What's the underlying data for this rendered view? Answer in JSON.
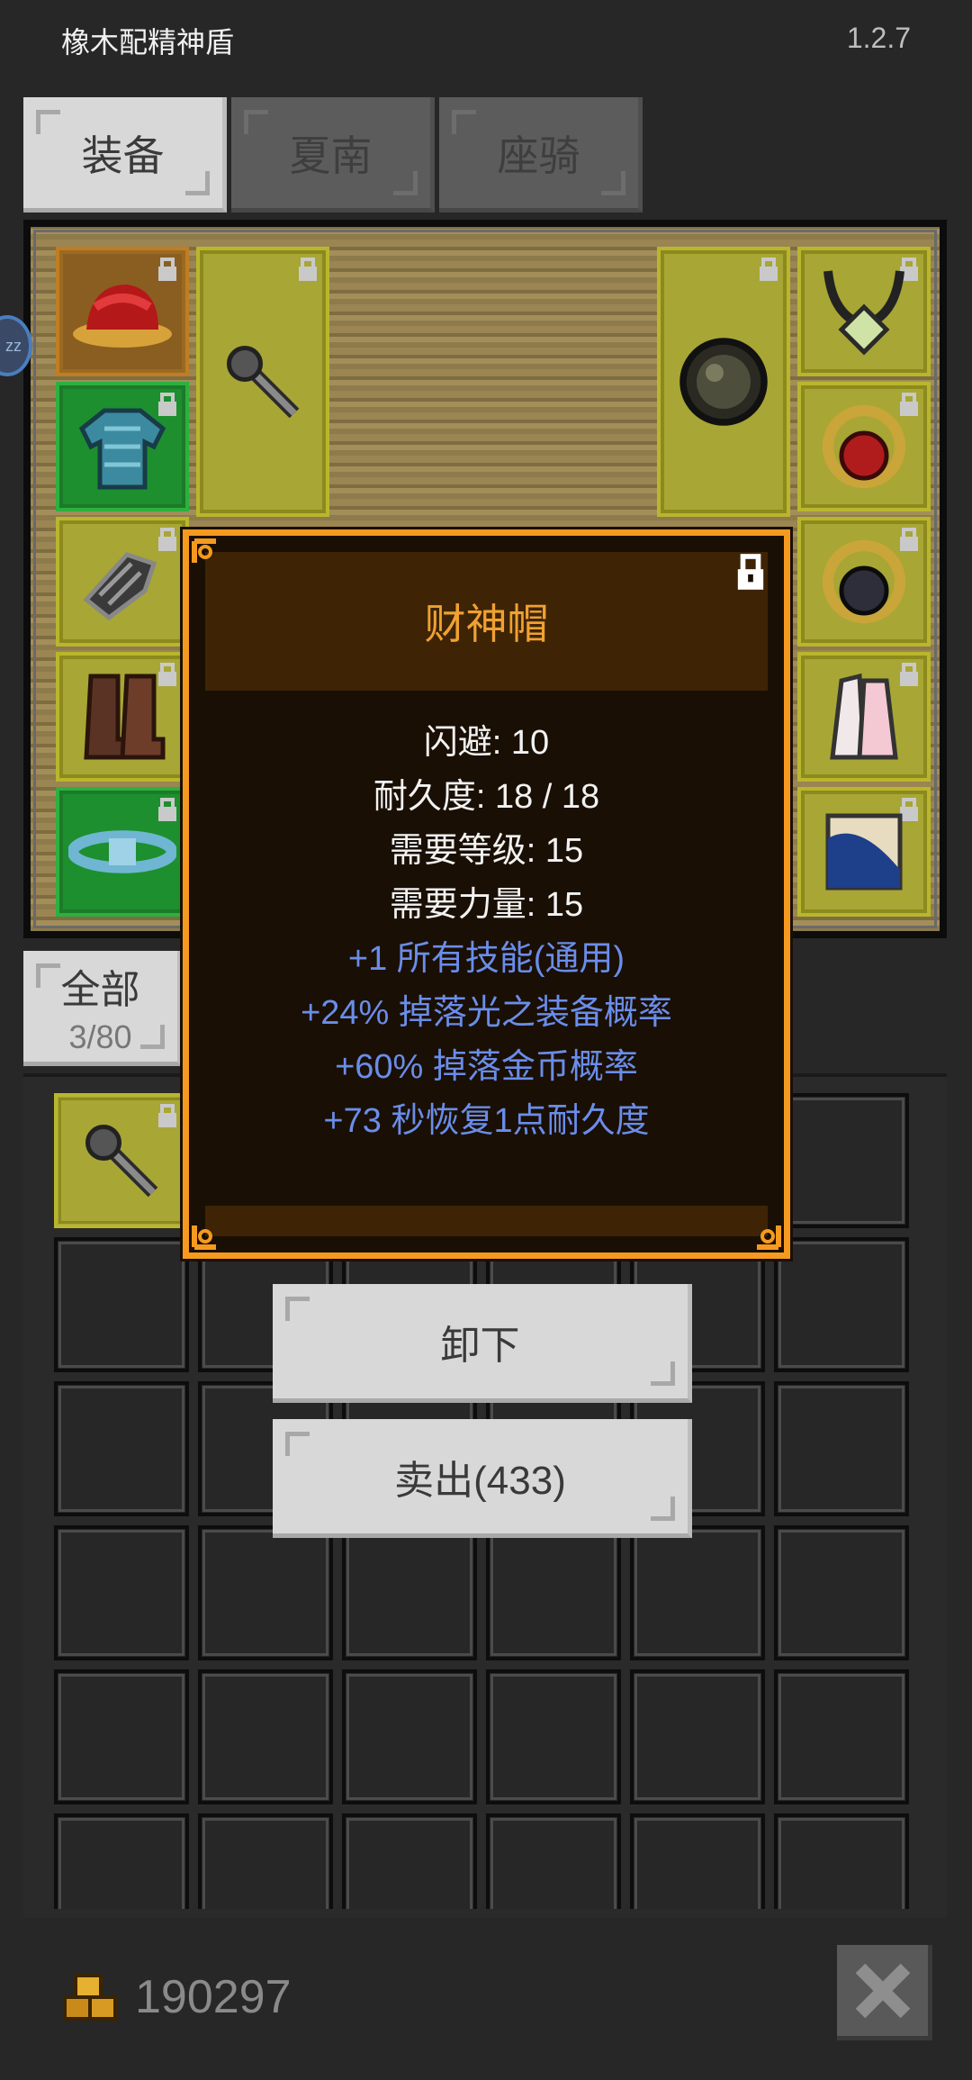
{
  "header": {
    "title": "橡木配精神盾",
    "version": "1.2.7"
  },
  "tabs": [
    {
      "label": "装备",
      "active": true
    },
    {
      "label": "夏南",
      "active": false
    },
    {
      "label": "座骑",
      "active": false
    }
  ],
  "side_badge": "zz",
  "equipment_slots": [
    {
      "slot": "head",
      "icon": "red-hat-icon",
      "locked": true
    },
    {
      "slot": "weapon",
      "icon": "mace-icon",
      "locked": true
    },
    {
      "slot": "offhand",
      "icon": "round-shield-icon",
      "locked": true
    },
    {
      "slot": "amulet",
      "icon": "amulet-icon",
      "locked": true
    },
    {
      "slot": "armor",
      "icon": "chainmail-icon",
      "locked": true
    },
    {
      "slot": "ring-1",
      "icon": "ruby-ring-icon",
      "locked": true
    },
    {
      "slot": "gloves",
      "icon": "gauntlet-icon",
      "locked": true
    },
    {
      "slot": "ring-2",
      "icon": "onyx-ring-icon",
      "locked": true
    },
    {
      "slot": "boots",
      "icon": "boots-icon",
      "locked": true
    },
    {
      "slot": "charm",
      "icon": "feather-charm-icon",
      "locked": true
    },
    {
      "slot": "belt",
      "icon": "belt-icon",
      "locked": true
    },
    {
      "slot": "scroll",
      "icon": "scroll-icon",
      "locked": true
    }
  ],
  "inventory": {
    "filter_label": "全部",
    "count": "3/80",
    "items": [
      {
        "icon": "mace-icon",
        "locked": true
      }
    ]
  },
  "tooltip": {
    "name": "财神帽",
    "stats": [
      {
        "text": "闪避: 10",
        "color": "white"
      },
      {
        "text": "耐久度: 18 / 18",
        "color": "white"
      },
      {
        "text": "需要等级: 15",
        "color": "white"
      },
      {
        "text": "需要力量: 15",
        "color": "white"
      },
      {
        "text": "+1 所有技能(通用)",
        "color": "blue"
      },
      {
        "text": "+24% 掉落光之装备概率",
        "color": "blue"
      },
      {
        "text": "+60% 掉落金币概率",
        "color": "blue"
      },
      {
        "text": "+73 秒恢复1点耐久度",
        "color": "blue"
      }
    ],
    "locked": true
  },
  "actions": {
    "unequip": "卸下",
    "sell": "卖出(433)"
  },
  "footer": {
    "gold": "190297"
  },
  "colors": {
    "tooltip_border": "#f59a1f",
    "item_name": "#f0a132",
    "magic_text": "#6a8dea"
  }
}
